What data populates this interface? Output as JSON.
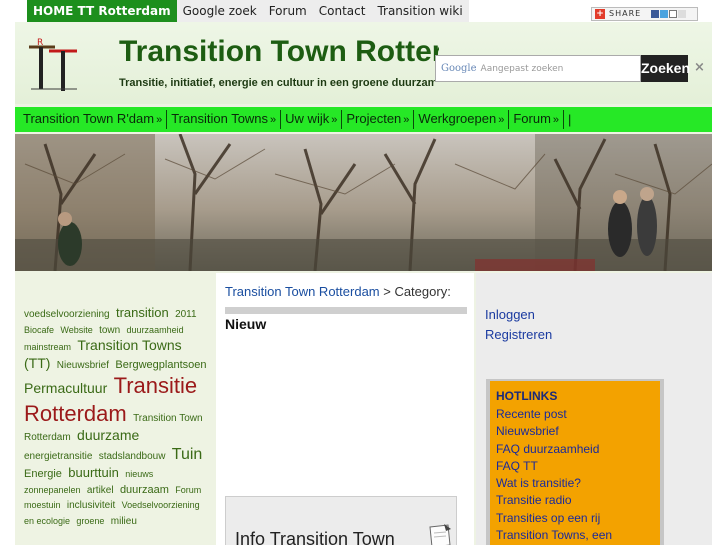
{
  "topnav": {
    "items": [
      {
        "label": "HOME TT Rotterdam",
        "active": true
      },
      {
        "label": "Google zoek",
        "active": false
      },
      {
        "label": "Forum",
        "active": false
      },
      {
        "label": "Contact",
        "active": false
      },
      {
        "label": "Transition wiki",
        "active": false
      }
    ],
    "share_label": "SHARE"
  },
  "header": {
    "title": "Transition Town Rotterdam",
    "tagline": "Transitie, initiatief, energie en cultuur in een groene duurzame stad",
    "search_placeholder": "Aangepast zoeken",
    "search_brand": "Google",
    "search_button": "Zoeken",
    "close_symbol": "×"
  },
  "mainmenu": {
    "items": [
      {
        "label": "Transition Town R'dam"
      },
      {
        "label": "Transition Towns"
      },
      {
        "label": "Uw wijk"
      },
      {
        "label": "Projecten"
      },
      {
        "label": "Werkgroepen"
      },
      {
        "label": "Forum"
      }
    ],
    "arrow": "»",
    "trailing": "|"
  },
  "tagcloud": [
    {
      "text": "voedselvoorziening",
      "size": 2
    },
    {
      "text": "transition",
      "size": 4
    },
    {
      "text": "2011",
      "size": 2
    },
    {
      "text": "Biocafe",
      "size": 1
    },
    {
      "text": "Website",
      "size": 1
    },
    {
      "text": "town",
      "size": 2
    },
    {
      "text": "duurzaamheid",
      "size": 1
    },
    {
      "text": "mainstream",
      "size": 1
    },
    {
      "text": "Transition Towns (TT)",
      "size": 5
    },
    {
      "text": "Nieuwsbrief",
      "size": 2
    },
    {
      "text": "Bergwegplantsoen",
      "size": 3
    },
    {
      "text": "Permacultuur",
      "size": 5
    },
    {
      "text": "Transitie Rotterdam",
      "size": 7
    },
    {
      "text": "Transition Town Rotterdam",
      "size": 2
    },
    {
      "text": "duurzame",
      "size": 5
    },
    {
      "text": "energietransitie",
      "size": 2
    },
    {
      "text": "stadslandbouw",
      "size": 2
    },
    {
      "text": "Tuin",
      "size": 6
    },
    {
      "text": "Energie",
      "size": 3
    },
    {
      "text": "buurttuin",
      "size": 4
    },
    {
      "text": "nieuws",
      "size": 1
    },
    {
      "text": "zonnepanelen",
      "size": 1
    },
    {
      "text": "artikel",
      "size": 2
    },
    {
      "text": "duurzaam",
      "size": 3
    },
    {
      "text": "Forum",
      "size": 1
    },
    {
      "text": "moestuin",
      "size": 1
    },
    {
      "text": "inclusiviteit",
      "size": 2
    },
    {
      "text": "Voedselvoorziening",
      "size": 1
    },
    {
      "text": "en ecologie",
      "size": 1
    },
    {
      "text": "groene",
      "size": 1
    },
    {
      "text": "milieu",
      "size": 2
    }
  ],
  "content": {
    "breadcrumb_link": "Transition Town Rotterdam",
    "breadcrumb_rest": " > Category:",
    "category_title": "Nieuw",
    "info_box_title": "Info Transition Town"
  },
  "sidebar": {
    "login": "Inloggen",
    "register": "Registreren",
    "hotlinks_title": "HOTLINKS",
    "hotlinks": [
      "Recente post",
      "Nieuwsbrief",
      "FAQ duurzaamheid",
      "FAQ TT",
      "Wat is transitie?",
      "Transitie radio",
      "Transities op een rij",
      "Transition Towns, een"
    ]
  },
  "colors": {
    "menu_green": "#26e826",
    "title_green": "#1d5d12",
    "tag_highlight": "#9b1a1a",
    "hotlinks_orange": "#f3a200",
    "home_green": "#1d8f1d"
  }
}
